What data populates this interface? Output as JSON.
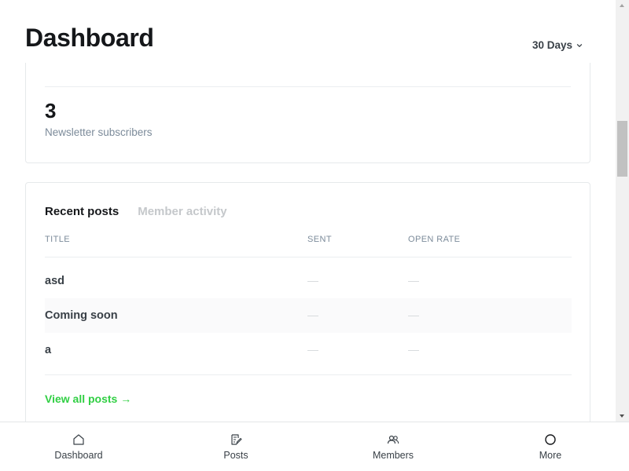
{
  "header": {
    "title": "Dashboard",
    "range_label": "30 Days"
  },
  "subscribers": {
    "value": "3",
    "label": "Newsletter subscribers"
  },
  "posts_card": {
    "tabs": [
      {
        "label": "Recent posts",
        "active": true
      },
      {
        "label": "Member activity",
        "active": false
      }
    ],
    "columns": [
      "TITLE",
      "SENT",
      "OPEN RATE"
    ],
    "rows": [
      {
        "title": "asd",
        "sent": "—",
        "open_rate": "—"
      },
      {
        "title": "Coming soon",
        "sent": "—",
        "open_rate": "—"
      },
      {
        "title": "a",
        "sent": "—",
        "open_rate": "—"
      }
    ],
    "view_all_label": "View all posts →"
  },
  "bottom_nav": {
    "items": [
      {
        "label": "Dashboard",
        "icon": "home-icon"
      },
      {
        "label": "Posts",
        "icon": "posts-icon"
      },
      {
        "label": "Members",
        "icon": "members-icon"
      },
      {
        "label": "More",
        "icon": "circle-icon"
      }
    ]
  },
  "colors": {
    "accent": "#30cf43",
    "text": "#15171a",
    "muted": "#7c8b9a"
  }
}
